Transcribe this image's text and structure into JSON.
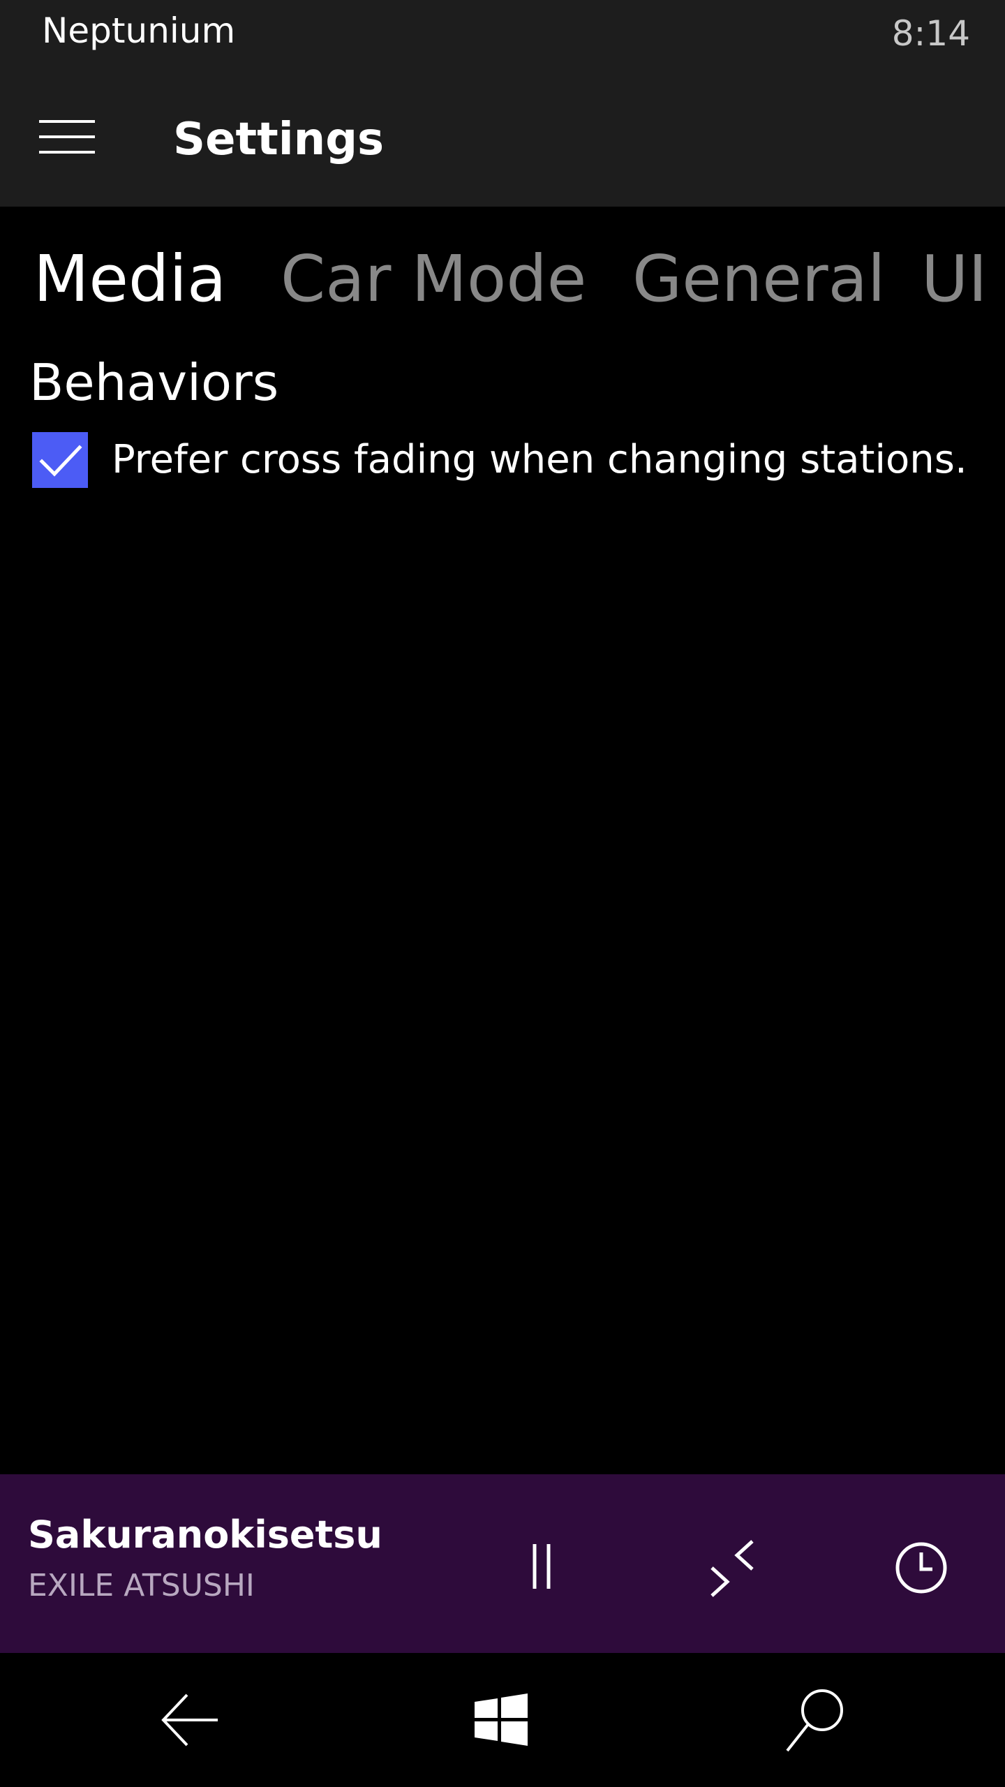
{
  "status": {
    "app_name": "Neptunium",
    "time": "8:14"
  },
  "header": {
    "title": "Settings",
    "menu_icon": "hamburger-icon"
  },
  "pivot": {
    "tabs": [
      {
        "label": "Media",
        "active": true
      },
      {
        "label": "Car Mode",
        "active": false
      },
      {
        "label": "General",
        "active": false
      },
      {
        "label": "UI",
        "active": false
      }
    ]
  },
  "behaviors": {
    "title": "Behaviors",
    "crossfade": {
      "label": "Prefer cross fading when changing stations.",
      "checked": true
    }
  },
  "now_playing": {
    "title": "Sakuranokisetsu",
    "artist": "EXILE ATSUSHI",
    "controls": [
      "pause-icon",
      "cast-icon",
      "sleep-timer-icon"
    ]
  },
  "navigation": {
    "buttons": [
      "back-arrow-icon",
      "windows-logo-icon",
      "search-icon"
    ]
  },
  "colors": {
    "accent": "#4c5cf5",
    "header_background": "#1d1d1d",
    "page_background": "#000000",
    "now_playing_background": "#2e0b3b",
    "inactive_tab": "#888888"
  }
}
